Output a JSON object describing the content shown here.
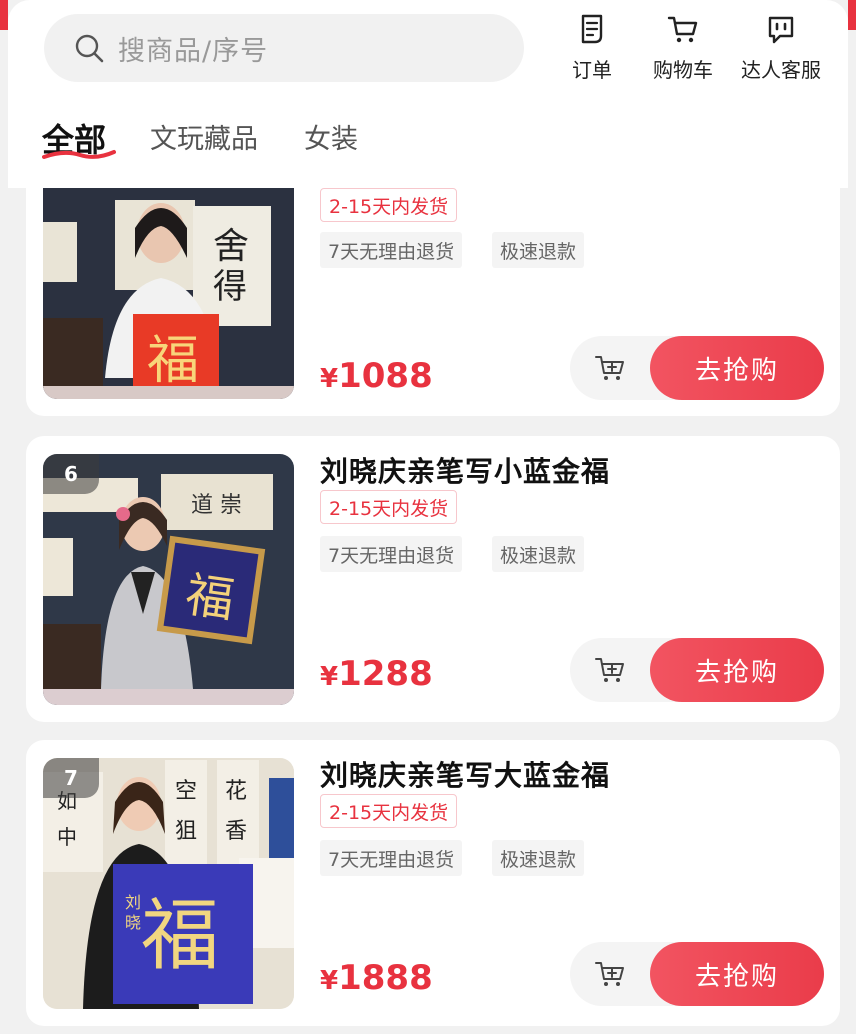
{
  "header": {
    "search_placeholder": "搜商品/序号",
    "order_label": "订单",
    "cart_label": "购物车",
    "service_label": "达人客服"
  },
  "tabs": [
    {
      "label": "全部",
      "active": true
    },
    {
      "label": "文玩藏品",
      "active": false
    },
    {
      "label": "女装",
      "active": false
    }
  ],
  "products": [
    {
      "rank": "",
      "title": "",
      "shipping": "2-15天内发货",
      "tags": [
        "7天无理由退货",
        "极速退款"
      ],
      "price_symbol": "¥",
      "price": "1088",
      "cart_icon": "add-to-cart-icon",
      "buy_label": "去抢购"
    },
    {
      "rank": "6",
      "title": "刘晓庆亲笔写小蓝金福",
      "shipping": "2-15天内发货",
      "tags": [
        "7天无理由退货",
        "极速退款"
      ],
      "price_symbol": "¥",
      "price": "1288",
      "cart_icon": "add-to-cart-icon",
      "buy_label": "去抢购"
    },
    {
      "rank": "7",
      "title": "刘晓庆亲笔写大蓝金福",
      "shipping": "2-15天内发货",
      "tags": [
        "7天无理由退货",
        "极速退款"
      ],
      "price_symbol": "¥",
      "price": "1888",
      "cart_icon": "add-to-cart-icon",
      "buy_label": "去抢购"
    }
  ],
  "colors": {
    "accent": "#e8323f",
    "background": "#f1f1f1",
    "card": "#ffffff"
  }
}
